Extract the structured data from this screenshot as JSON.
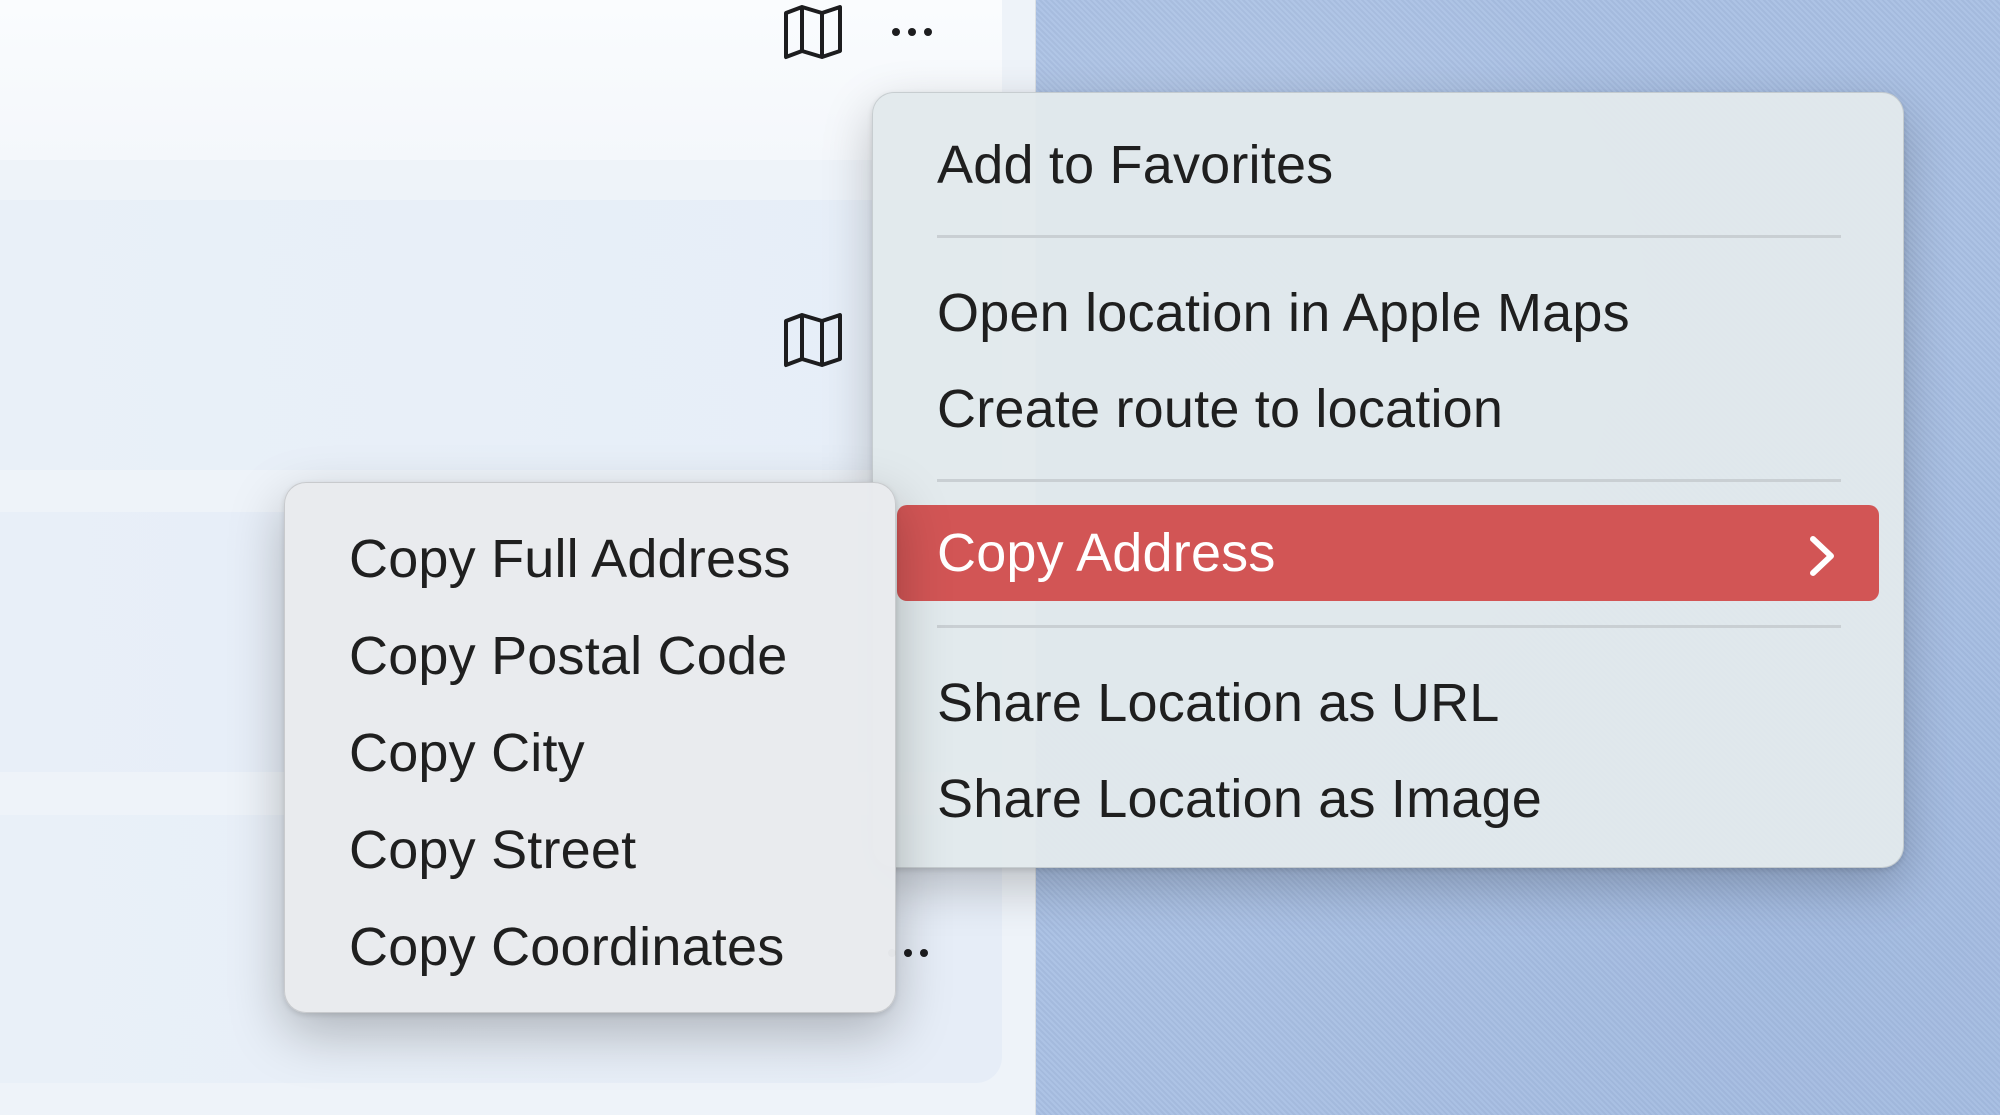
{
  "icons": {
    "map_icon_top": "map-icon",
    "more_icon_top": "more-icon",
    "map_icon_row": "map-icon",
    "more_icon_row": "more-icon"
  },
  "context_menu": {
    "items": [
      {
        "label": "Add to Favorites"
      },
      {
        "label": "Open location in Apple Maps"
      },
      {
        "label": "Create route to location"
      },
      {
        "label": "Copy Address",
        "highlighted": true,
        "has_submenu": true
      },
      {
        "label": "Share Location as URL"
      },
      {
        "label": "Share Location as Image"
      }
    ],
    "highlight_color": "#d25555"
  },
  "submenu": {
    "items": [
      {
        "label": "Copy Full Address"
      },
      {
        "label": "Copy Postal Code"
      },
      {
        "label": "Copy City"
      },
      {
        "label": "Copy Street"
      },
      {
        "label": "Copy Coordinates"
      }
    ]
  }
}
